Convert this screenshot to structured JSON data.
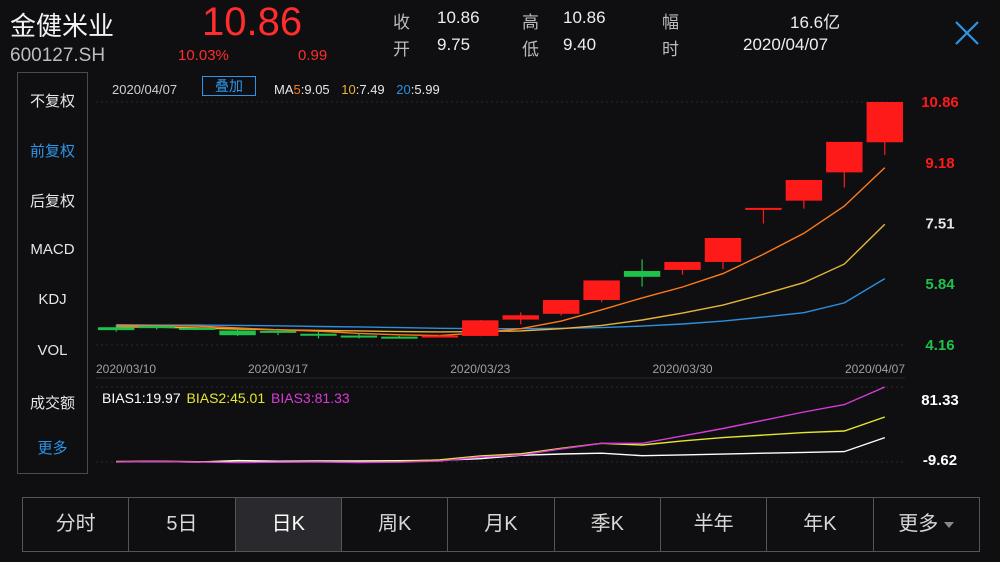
{
  "header": {
    "name": "金健米业",
    "code": "600127.SH",
    "price": "10.86",
    "change_pct": "10.03%",
    "change": "0.99",
    "quote": [
      {
        "label": "收",
        "value": "10.86"
      },
      {
        "label": "开",
        "value": "9.75"
      },
      {
        "label": "高",
        "value": "10.86"
      },
      {
        "label": "低",
        "value": "9.40"
      },
      {
        "label": "幅",
        "value": "16.6亿"
      },
      {
        "label": "时",
        "value": "2020/04/07"
      }
    ]
  },
  "sidebar": {
    "items": [
      {
        "label": "不复权",
        "active": false
      },
      {
        "label": "前复权",
        "active": true
      },
      {
        "label": "后复权",
        "active": false
      },
      {
        "label": "MACD",
        "active": false
      },
      {
        "label": "KDJ",
        "active": false
      },
      {
        "label": "VOL",
        "active": false
      },
      {
        "label": "成交额",
        "active": false
      },
      {
        "label": "更多",
        "active": true
      }
    ]
  },
  "legend": {
    "date": "2020/04/07",
    "overlay_button": "叠加",
    "ma_prefix": "MA",
    "ma5_key": "5",
    "ma5_value": ":9.05",
    "ma10_key": "10",
    "ma10_value": ":7.49",
    "ma20_key": "20",
    "ma20_value": ":5.99"
  },
  "bias_legend": {
    "bias1": "BIAS1:19.97",
    "bias2": "BIAS2:45.01",
    "bias3": "BIAS3:81.33"
  },
  "colors": {
    "up": "#ff1a1a",
    "down": "#1ec24b",
    "ma5": "#ff7a1a",
    "ma10": "#e8b43a",
    "ma20": "#2c8fe0",
    "bias1": "#ffffff",
    "bias2": "#e6e62e",
    "bias3": "#d63bd6"
  },
  "chart_data": [
    {
      "type": "candlestick",
      "title": "",
      "x_tick_labels": [
        "2020/03/10",
        "2020/03/17",
        "2020/03/23",
        "2020/03/30",
        "2020/04/07"
      ],
      "x_tick_index": [
        0,
        4,
        9,
        14,
        19
      ],
      "y_tick_labels": [
        "10.86",
        "9.18",
        "7.51",
        "5.84",
        "4.16"
      ],
      "ylim": [
        4.16,
        10.86
      ],
      "candles": [
        {
          "o": 4.65,
          "h": 4.71,
          "l": 4.53,
          "c": 4.57
        },
        {
          "o": 4.68,
          "h": 4.73,
          "l": 4.59,
          "c": 4.66
        },
        {
          "o": 4.63,
          "h": 4.66,
          "l": 4.57,
          "c": 4.6
        },
        {
          "o": 4.56,
          "h": 4.6,
          "l": 4.41,
          "c": 4.43
        },
        {
          "o": 4.55,
          "h": 4.61,
          "l": 4.43,
          "c": 4.52
        },
        {
          "o": 4.47,
          "h": 4.53,
          "l": 4.34,
          "c": 4.46
        },
        {
          "o": 4.42,
          "h": 4.48,
          "l": 4.34,
          "c": 4.38
        },
        {
          "o": 4.39,
          "h": 4.41,
          "l": 4.34,
          "c": 4.37
        },
        {
          "o": 4.39,
          "h": 4.44,
          "l": 4.37,
          "c": 4.42
        },
        {
          "o": 4.41,
          "h": 4.85,
          "l": 4.4,
          "c": 4.84
        },
        {
          "o": 4.86,
          "h": 5.06,
          "l": 4.73,
          "c": 4.98
        },
        {
          "o": 5.02,
          "h": 5.4,
          "l": 4.97,
          "c": 5.4
        },
        {
          "o": 5.4,
          "h": 5.94,
          "l": 5.34,
          "c": 5.94
        },
        {
          "o": 6.2,
          "h": 6.52,
          "l": 5.77,
          "c": 6.04
        },
        {
          "o": 6.23,
          "h": 6.45,
          "l": 6.1,
          "c": 6.45
        },
        {
          "o": 6.45,
          "h": 7.11,
          "l": 6.25,
          "c": 7.11
        },
        {
          "o": 7.92,
          "h": 7.94,
          "l": 7.51,
          "c": 7.94
        },
        {
          "o": 8.14,
          "h": 8.71,
          "l": 7.92,
          "c": 8.71
        },
        {
          "o": 8.92,
          "h": 9.76,
          "l": 8.5,
          "c": 9.76
        },
        {
          "o": 9.75,
          "h": 10.86,
          "l": 9.4,
          "c": 10.86
        }
      ],
      "ma5": [
        4.7,
        4.69,
        4.68,
        4.63,
        4.58,
        4.54,
        4.48,
        4.44,
        4.42,
        4.5,
        4.61,
        4.82,
        5.13,
        5.46,
        5.76,
        6.13,
        6.66,
        7.24,
        7.99,
        9.05
      ],
      "ma10": [
        4.66,
        4.65,
        4.63,
        4.6,
        4.58,
        4.56,
        4.55,
        4.53,
        4.52,
        4.53,
        4.55,
        4.61,
        4.7,
        4.85,
        5.04,
        5.26,
        5.56,
        5.88,
        6.39,
        7.49
      ],
      "ma20": [
        4.72,
        4.71,
        4.71,
        4.7,
        4.69,
        4.67,
        4.66,
        4.64,
        4.62,
        4.61,
        4.61,
        4.62,
        4.64,
        4.68,
        4.74,
        4.82,
        4.93,
        5.05,
        5.32,
        5.99
      ]
    },
    {
      "type": "line",
      "title": "BIAS",
      "y_tick_labels": [
        "81.33",
        "-9.62"
      ],
      "ylim": [
        -9.62,
        81.33
      ],
      "series": [
        {
          "name": "BIAS1",
          "values": [
            -9.4,
            -9.0,
            -9.8,
            -7.9,
            -8.7,
            -8.4,
            -8.3,
            -8.0,
            -7.6,
            -5.6,
            -1.5,
            0.1,
            1.0,
            -2.0,
            -1.0,
            0.0,
            1.0,
            2.0,
            3.0,
            19.97
          ]
        },
        {
          "name": "BIAS2",
          "values": [
            -9.0,
            -8.6,
            -9.3,
            -10.0,
            -9.8,
            -9.3,
            -9.7,
            -9.0,
            -6.9,
            -2.2,
            0.3,
            7.0,
            13.0,
            11.0,
            16.0,
            20.0,
            23.0,
            26.0,
            28.0,
            45.01
          ]
        },
        {
          "name": "BIAS3",
          "values": [
            -9.6,
            -9.0,
            -9.8,
            -10.4,
            -9.9,
            -9.7,
            -10.2,
            -9.9,
            -8.5,
            -3.6,
            -1.3,
            6.3,
            13.0,
            13.0,
            22.0,
            31.0,
            41.0,
            51.0,
            60.0,
            81.33
          ]
        }
      ]
    }
  ]
}
